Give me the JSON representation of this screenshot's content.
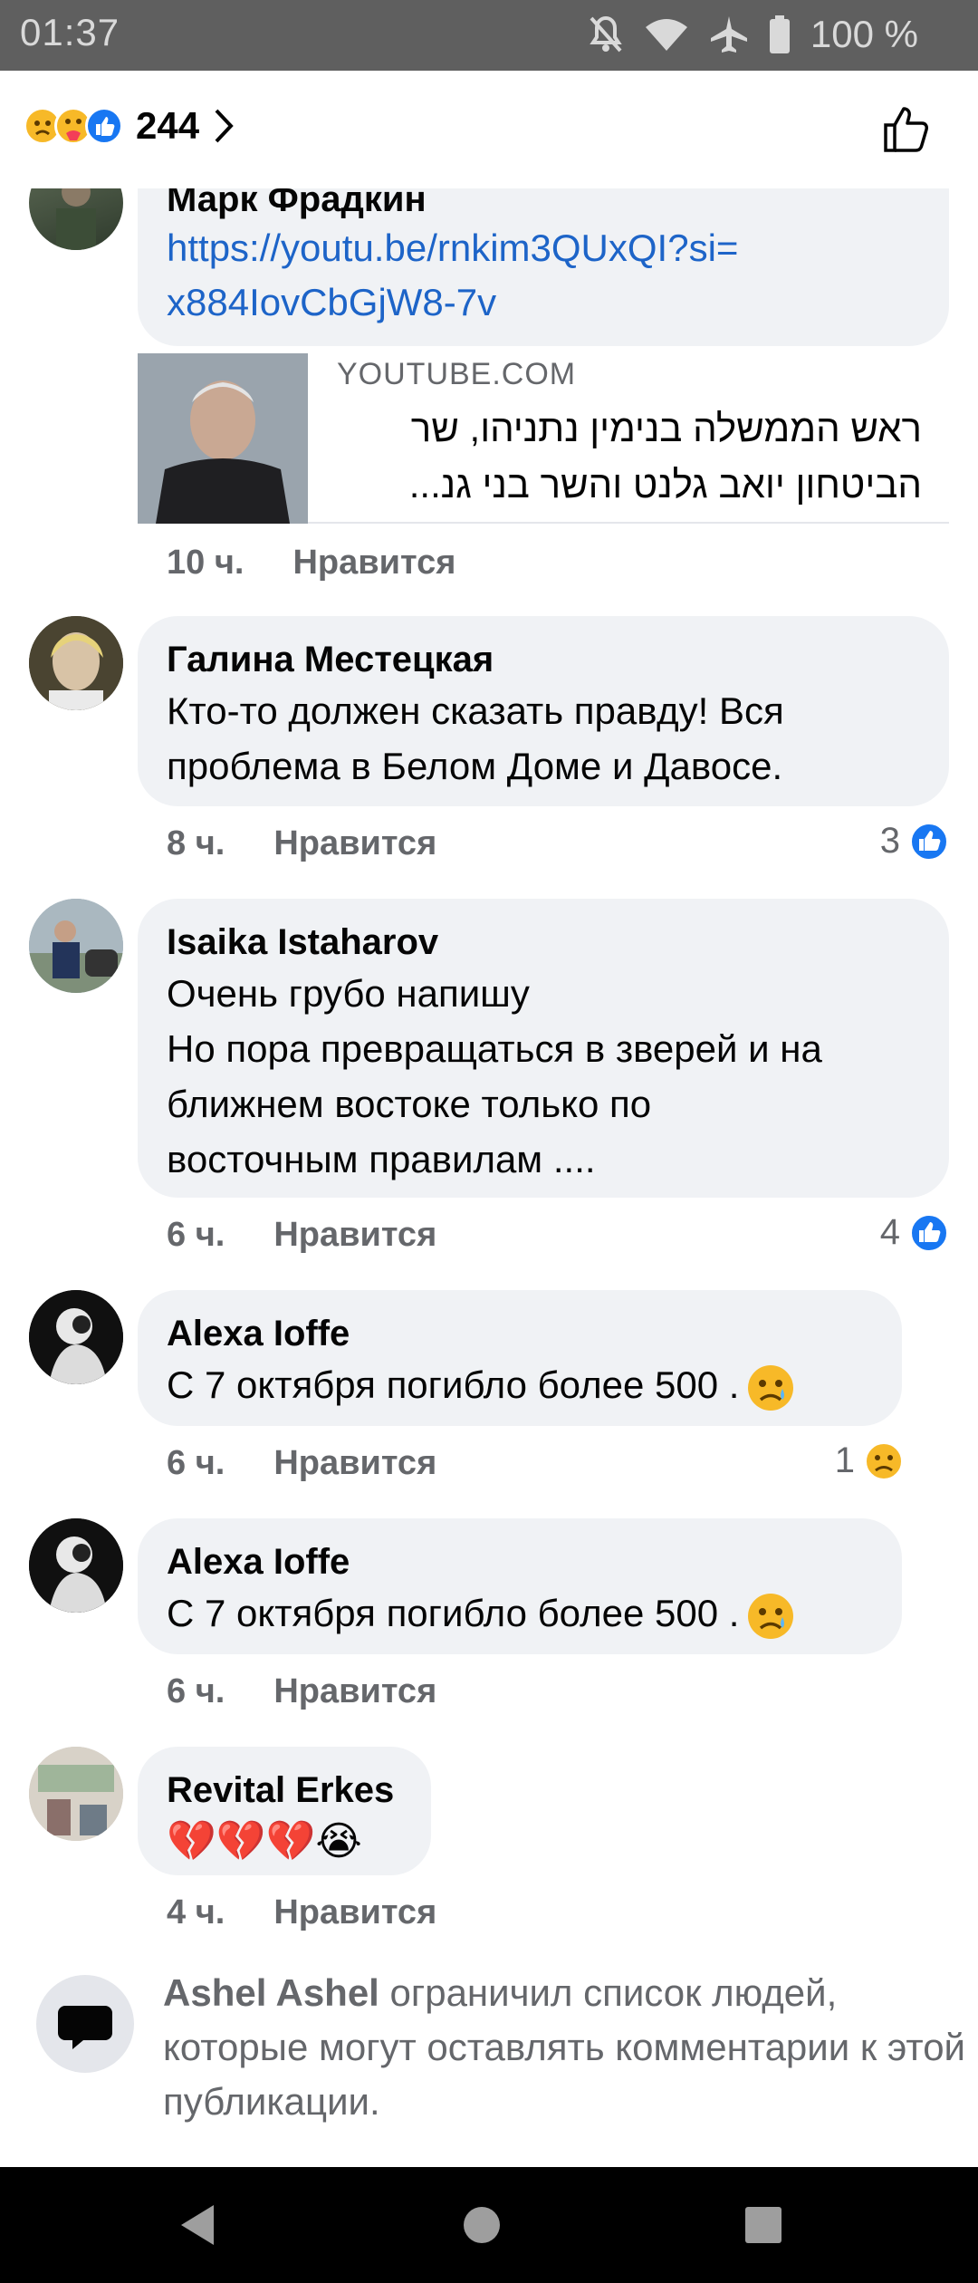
{
  "status_bar": {
    "time": "01:37",
    "battery": "100 %",
    "icons": [
      "dnd-off-icon",
      "wifi-icon",
      "airplane-icon",
      "battery-icon"
    ]
  },
  "reactions_header": {
    "count": "244",
    "reactions": [
      "sad",
      "care",
      "like"
    ]
  },
  "comments": [
    {
      "author": "Марк Фрадкин",
      "link": "https://youtu.be/rnkim3QUxQI?si=\nx884IovCbGjW8-7v",
      "preview_domain": "YOUTUBE.COM",
      "preview_title": "ראש הממשלה בנימין נתניהו, שר הביטחון יואב גלנט והשר בני גנ...",
      "time": "10 ч.",
      "like_label": "Нравится"
    },
    {
      "author": "Галина Местецкая",
      "text": "Кто-то должен сказать правду! Вся\nпроблема в Белом Доме и Давосе.",
      "time": "8 ч.",
      "like_label": "Нравится",
      "reaction_count": "3"
    },
    {
      "author": "Isaika Istaharov",
      "text": "Очень грубо напишу\nНо пора превращаться в зверей и на\nближнем востоке только по\nвосточным правилам ....",
      "time": "6 ч.",
      "like_label": "Нравится",
      "reaction_count": "4"
    },
    {
      "author": "Alexa Ioffe",
      "text": "С 7 октября погибло более 500 .",
      "time": "6 ч.",
      "like_label": "Нравится",
      "reaction_count": "1"
    },
    {
      "author": "Alexa Ioffe",
      "text": "С 7 октября погибло более 500 .",
      "time": "6 ч.",
      "like_label": "Нравится"
    },
    {
      "author": "Revital Erkes",
      "text": "💔💔💔😭",
      "time": "4 ч.",
      "like_label": "Нравится"
    }
  ],
  "notice": {
    "name": "Ashel Ashel",
    "text": " ограничил список людей, которые могут оставлять комментарии к этой публикации."
  },
  "colors": {
    "status_bar": "#5f5f5f",
    "bubble": "#f0f2f5",
    "link": "#1d64c8",
    "like_blue": "#1877f2",
    "meta_gray": "#65676b"
  }
}
